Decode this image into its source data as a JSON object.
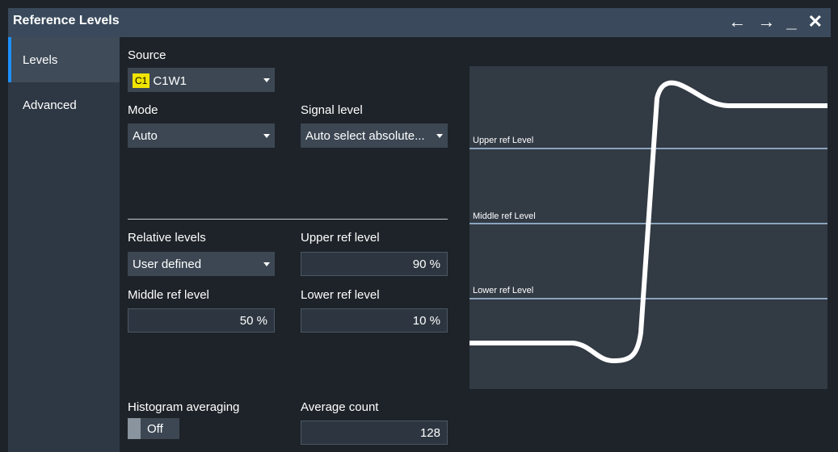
{
  "window": {
    "title": "Reference Levels",
    "controls": {
      "back": "←",
      "forward": "→",
      "minimize": "_",
      "close": "✕"
    }
  },
  "sidebar": {
    "items": [
      {
        "label": "Levels",
        "active": true
      },
      {
        "label": "Advanced",
        "active": false
      }
    ]
  },
  "source": {
    "label": "Source",
    "chip": "C1",
    "value": "C1W1"
  },
  "mode": {
    "label": "Mode",
    "value": "Auto"
  },
  "signal_level": {
    "label": "Signal level",
    "value": "Auto select absolute..."
  },
  "relative_levels": {
    "label": "Relative levels",
    "value": "User defined"
  },
  "upper_ref": {
    "label": "Upper ref level",
    "value": "90 %"
  },
  "middle_ref": {
    "label": "Middle ref level",
    "value": "50 %"
  },
  "lower_ref": {
    "label": "Lower ref level",
    "value": "10 %"
  },
  "histogram": {
    "label": "Histogram averaging",
    "value": "Off"
  },
  "average_count": {
    "label": "Average count",
    "value": "128"
  },
  "diagram": {
    "upper_label": "Upper ref Level",
    "middle_label": "Middle ref Level",
    "lower_label": "Lower ref Level"
  },
  "colors": {
    "accent": "#1e90ff",
    "chip": "#f0e400",
    "title_bar": "#3a4a5c",
    "ref_line": "#8aa4bd",
    "signal": "#ffffff"
  }
}
